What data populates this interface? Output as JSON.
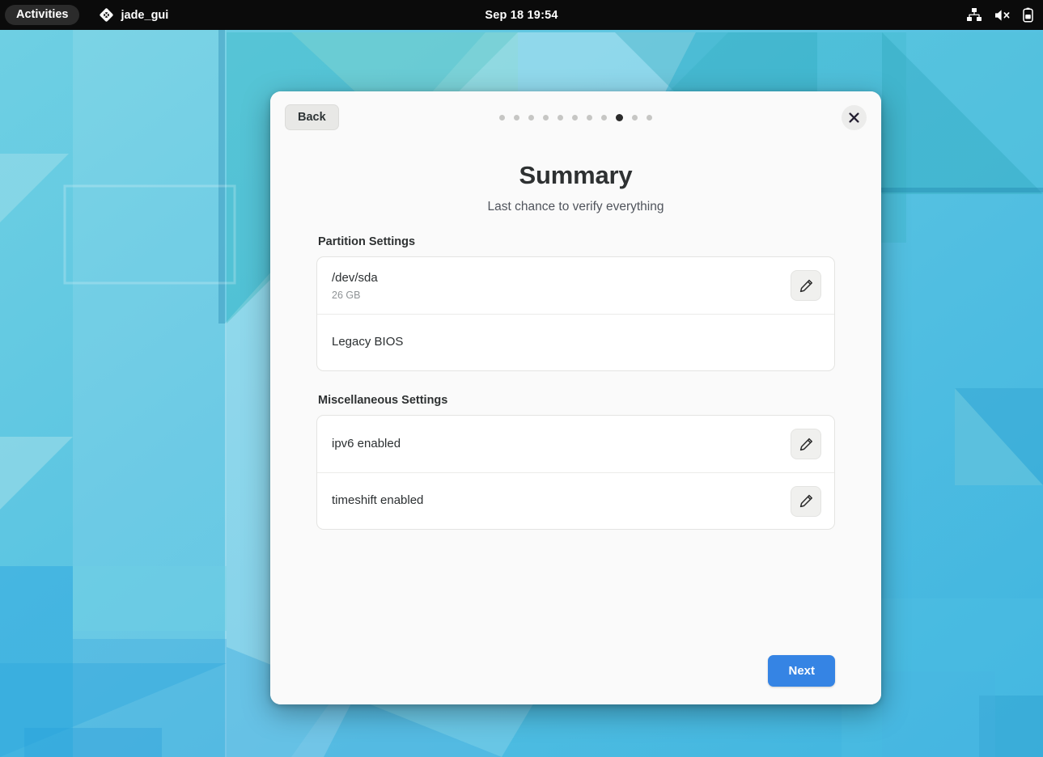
{
  "topbar": {
    "activities_label": "Activities",
    "app_name": "jade_gui",
    "app_icon": "jade-diamond-icon",
    "clock": "Sep 18  19:54",
    "status_icons": [
      {
        "name": "network-wired-icon",
        "label": "network"
      },
      {
        "name": "volume-muted-icon",
        "label": "volume muted"
      },
      {
        "name": "battery-icon",
        "label": "battery"
      }
    ]
  },
  "dialog": {
    "back_label": "Back",
    "close_label": "✕",
    "pager": {
      "total": 11,
      "active_index": 8
    },
    "title": "Summary",
    "subtitle": "Last chance to verify everything",
    "next_label": "Next",
    "accent_color": "#3584e4",
    "sections": [
      {
        "heading": "Partition Settings",
        "rows": [
          {
            "title": "/dev/sda",
            "subtitle": "26 GB",
            "has_edit": true
          },
          {
            "title": "Legacy BIOS",
            "subtitle": "",
            "has_edit": false
          }
        ]
      },
      {
        "heading": "Miscellaneous Settings",
        "rows": [
          {
            "title": "ipv6 enabled",
            "subtitle": "",
            "has_edit": true
          },
          {
            "title": "timeshift enabled",
            "subtitle": "",
            "has_edit": true
          }
        ]
      }
    ]
  }
}
